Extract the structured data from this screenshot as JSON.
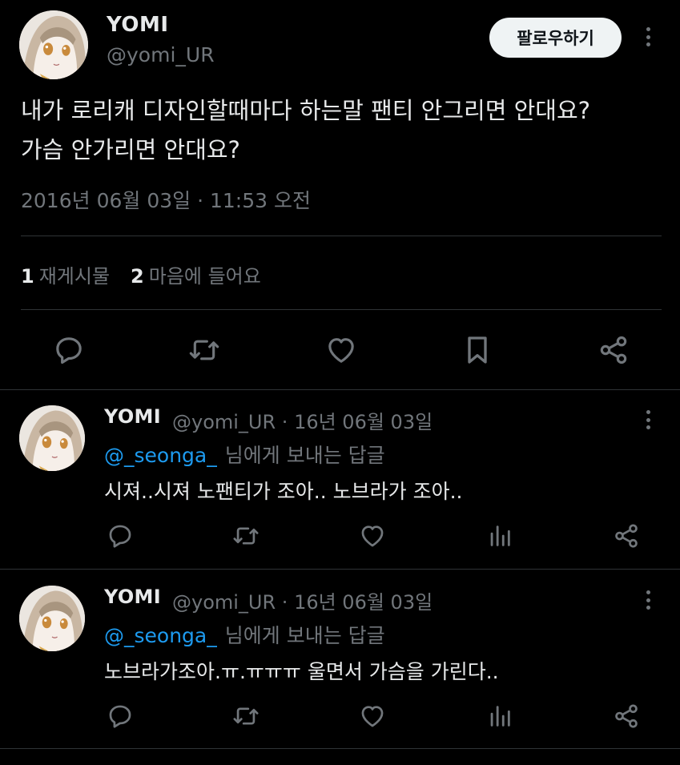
{
  "tweet": {
    "display_name": "YOMI",
    "handle": "@yomi_UR",
    "follow_label": "팔로우하기",
    "text_line1": "내가 로리캐 디자인할때마다 하는말 팬티 안그리면 안대요?",
    "text_line2": "가슴 안가리면 안대요?",
    "timestamp": "2016년 06월 03일 · 11:53 오전",
    "stats": {
      "reposts_count": "1",
      "reposts_label": "재게시물",
      "likes_count": "2",
      "likes_label": "마음에 들어요"
    }
  },
  "replies": [
    {
      "display_name": "YOMI",
      "meta": "@yomi_UR · 16년 06월 03일",
      "mention": "@_seonga_",
      "reply_suffix": "님에게 보내는 답글",
      "text": "시져..시져 노팬티가 조아.. 노브라가 조아.."
    },
    {
      "display_name": "YOMI",
      "meta": "@yomi_UR · 16년 06월 03일",
      "mention": "@_seonga_",
      "reply_suffix": "님에게 보내는 답글",
      "text": "노브라가조아.ㅠ.ㅠㅠㅠ 울면서 가슴을 가린다.."
    }
  ],
  "icons": {
    "reply": "reply-icon",
    "repost": "repost-icon",
    "like": "heart-icon",
    "bookmark": "bookmark-icon",
    "share": "share-icon",
    "views": "views-icon",
    "more": "more-icon"
  },
  "colors": {
    "background": "#000000",
    "text": "#e7e9ea",
    "secondary": "#71767b",
    "accent": "#1d9bf0",
    "divider": "#2f3336"
  }
}
